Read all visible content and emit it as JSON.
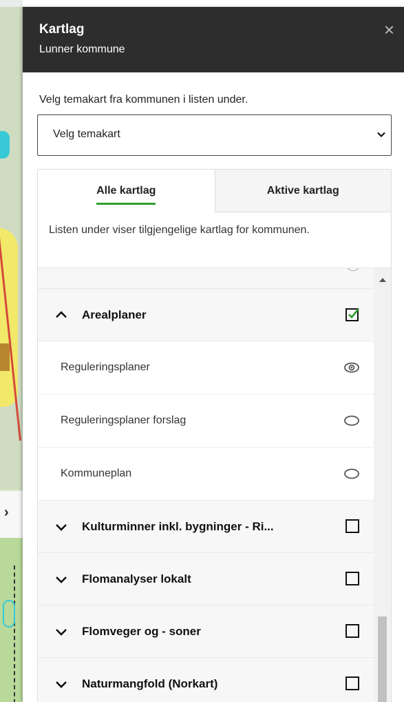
{
  "panel": {
    "title": "Kartlag",
    "subtitle": "Lunner kommune",
    "close_icon": "×"
  },
  "theme_select": {
    "instruction": "Velg temakart fra kommunen i listen under.",
    "value": "Velg temakart"
  },
  "tabs": {
    "all": "Alle kartlag",
    "active": "Aktive kartlag"
  },
  "description": "Listen under viser tilgjengelige kartlag for kommunen.",
  "layers": {
    "group1": {
      "name": "Arealplaner",
      "expanded": true,
      "checked": true
    },
    "sub1": {
      "name": "Reguleringsplaner",
      "visible": true
    },
    "sub2": {
      "name": "Reguleringsplaner forslag",
      "visible": false
    },
    "sub3": {
      "name": "Kommuneplan",
      "visible": false
    },
    "group2": {
      "name": "Kulturminner inkl. bygninger - Ri...",
      "expanded": false,
      "checked": false
    },
    "group3": {
      "name": "Flomanalyser lokalt",
      "expanded": false,
      "checked": false
    },
    "group4": {
      "name": "Flomveger og - soner",
      "expanded": false,
      "checked": false
    },
    "group5": {
      "name": "Naturmangfold (Norkart)",
      "expanded": false,
      "checked": false
    }
  },
  "colors": {
    "header_bg": "#2d2d2d",
    "accent_green": "#2e9e2e"
  }
}
